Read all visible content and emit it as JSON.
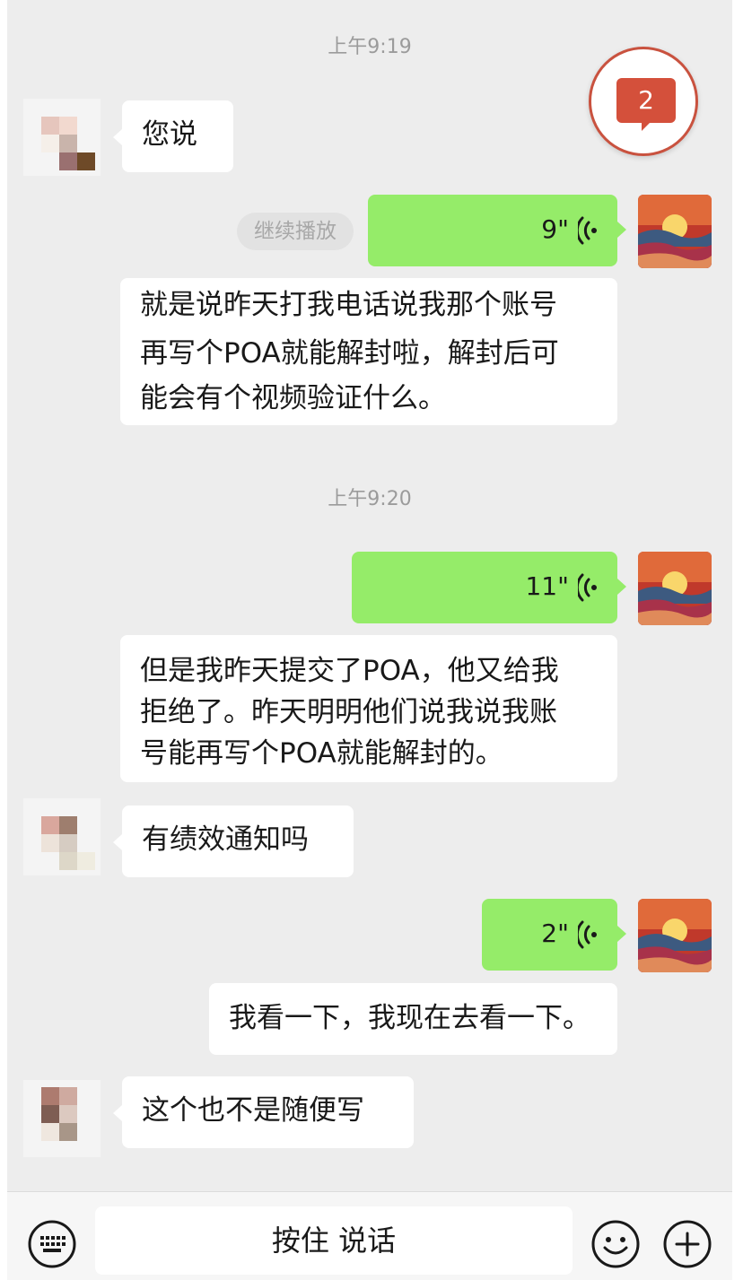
{
  "colors": {
    "sent_bubble": "#95ec69",
    "received_bubble": "#ffffff",
    "chat_bg": "#ededed",
    "badge": "#d4503b"
  },
  "timestamps": [
    "上午9:19",
    "上午9:20"
  ],
  "unread_badge": {
    "count": "2",
    "icon": "unread-message-icon"
  },
  "continue_play": "继续播放",
  "messages": [
    {
      "side": "left",
      "type": "text",
      "text": "您说"
    },
    {
      "side": "right",
      "type": "voice",
      "duration": "9\""
    },
    {
      "side": "right",
      "type": "transcript",
      "lines": [
        "就是说昨天打我电话说我那个账号",
        "再写个POA就能解封啦，解封后可",
        "能会有个视频验证什么。"
      ]
    },
    {
      "side": "right",
      "type": "voice",
      "duration": "11\""
    },
    {
      "side": "right",
      "type": "transcript",
      "lines": [
        "但是我昨天提交了POA，他又给我",
        "拒绝了。昨天明明他们说我说我账",
        "号能再写个POA就能解封的。"
      ]
    },
    {
      "side": "left",
      "type": "text",
      "text": "有绩效通知吗"
    },
    {
      "side": "right",
      "type": "voice",
      "duration": "2\""
    },
    {
      "side": "right",
      "type": "transcript",
      "lines": [
        "我看一下，我现在去看一下。"
      ]
    },
    {
      "side": "left",
      "type": "text",
      "text": "这个也不是随便写"
    }
  ],
  "input_bar": {
    "hold_to_talk": "按住 说话",
    "icons": [
      "keyboard-icon",
      "emoji-icon",
      "plus-icon"
    ]
  }
}
